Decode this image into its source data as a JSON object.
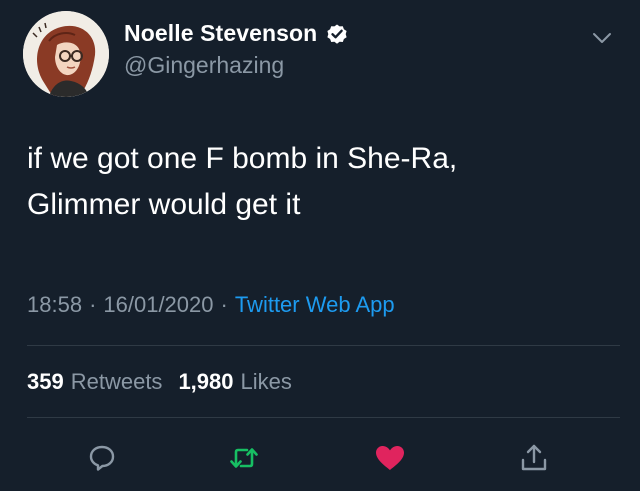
{
  "author": {
    "display_name": "Noelle Stevenson",
    "handle": "@Gingerhazing",
    "verified": true
  },
  "tweet": {
    "lines": [
      "if we got one F bomb in She-Ra,",
      "Glimmer would get it"
    ]
  },
  "meta": {
    "time": "18:58",
    "separator": "·",
    "date": "16/01/2020",
    "source": "Twitter Web App"
  },
  "stats": {
    "retweets_count": "359",
    "retweets_label": "Retweets",
    "likes_count": "1,980",
    "likes_label": "Likes"
  },
  "icons": {
    "reply": "speech-bubble-icon",
    "retweet": "retweet-arrows-icon",
    "like": "heart-icon",
    "share": "share-upload-icon",
    "more": "chevron-down-icon",
    "verified": "verified-badge-icon"
  },
  "colors": {
    "background": "#151f2b",
    "secondary_text": "#8b98a5",
    "link": "#1d9bf0",
    "retweet_green": "#17bf63",
    "like_pink": "#e0245e"
  }
}
